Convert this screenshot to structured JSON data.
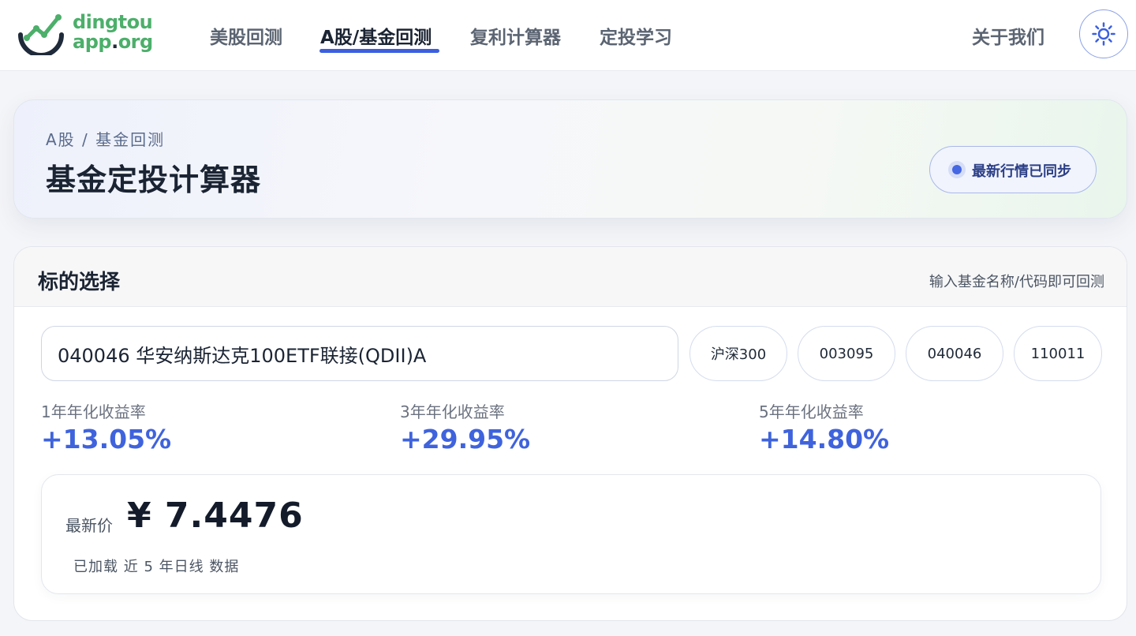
{
  "header": {
    "logo_line1": "dingtou",
    "logo_line2_a": "app",
    "logo_line2_b": ".org",
    "nav": [
      {
        "label": "美股回测",
        "active": false
      },
      {
        "label": "A股/基金回测",
        "active": true
      },
      {
        "label": "复利计算器",
        "active": false
      },
      {
        "label": "定投学习",
        "active": false
      }
    ],
    "about": "关于我们",
    "theme_icon": "sun-icon"
  },
  "hero": {
    "breadcrumb": "A股 / 基金回测",
    "title": "基金定投计算器",
    "sync_status": "最新行情已同步"
  },
  "selection": {
    "title": "标的选择",
    "hint": "输入基金名称/代码即可回测",
    "input_value": "040046 华安纳斯达克100ETF联接(QDII)A",
    "quick_picks": [
      "沪深300",
      "003095",
      "040046",
      "110011"
    ],
    "metrics": [
      {
        "label": "1年年化收益率",
        "value": "+13.05%"
      },
      {
        "label": "3年年化收益率",
        "value": "+29.95%"
      },
      {
        "label": "5年年化收益率",
        "value": "+14.80%"
      }
    ],
    "price": {
      "label": "最新价",
      "value": "¥ 7.4476",
      "note": "已加载 近 5 年日线 数据"
    }
  },
  "colors": {
    "accent": "#3f63dd",
    "brand_green": "#4caf6a",
    "text_dark": "#1b2433"
  }
}
